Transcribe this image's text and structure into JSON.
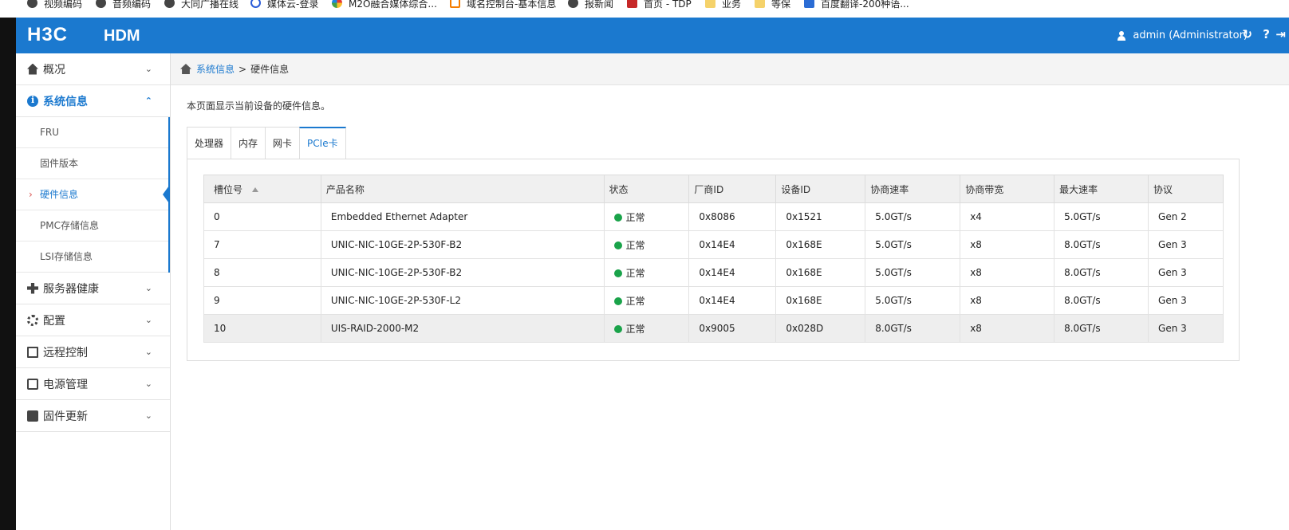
{
  "bookmarks": [
    {
      "label": "视频编码",
      "icon": "globe-icon"
    },
    {
      "label": "音频编码",
      "icon": "globe-icon"
    },
    {
      "label": "大同广播在线",
      "icon": "globe-icon"
    },
    {
      "label": "媒体云-登录",
      "icon": "play-icon"
    },
    {
      "label": "M2O融合媒体综合...",
      "icon": "m2o-icon"
    },
    {
      "label": "域名控制台-基本信息",
      "icon": "bracket-icon"
    },
    {
      "label": "报新闻",
      "icon": "globe-icon"
    },
    {
      "label": "首页 - TDP",
      "icon": "d-icon"
    },
    {
      "label": "业务",
      "icon": "folder-icon"
    },
    {
      "label": "等保",
      "icon": "folder-icon"
    },
    {
      "label": "百度翻译-200种语...",
      "icon": "translate-icon"
    }
  ],
  "header": {
    "logo": "H3C",
    "product": "HDM",
    "user": "admin (Administrator)",
    "refresh_icon": "↻",
    "help_icon": "?",
    "logout_icon": "⇥"
  },
  "sidebar": {
    "items": [
      {
        "label": "概况",
        "icon": "home-icon",
        "expanded": false
      },
      {
        "label": "系统信息",
        "icon": "info-icon",
        "expanded": true,
        "children": [
          {
            "label": "FRU"
          },
          {
            "label": "固件版本"
          },
          {
            "label": "硬件信息",
            "current": true
          },
          {
            "label": "PMC存储信息"
          },
          {
            "label": "LSI存储信息"
          }
        ]
      },
      {
        "label": "服务器健康",
        "icon": "health-icon",
        "expanded": false
      },
      {
        "label": "配置",
        "icon": "gear-icon",
        "expanded": false
      },
      {
        "label": "远程控制",
        "icon": "remote-icon",
        "expanded": false
      },
      {
        "label": "电源管理",
        "icon": "power-icon",
        "expanded": false
      },
      {
        "label": "固件更新",
        "icon": "update-icon",
        "expanded": false
      }
    ],
    "chevron_down": "⌄",
    "chevron_up": "⌃",
    "current_mark": "›"
  },
  "breadcrumb": {
    "parent": "系统信息",
    "separator": ">",
    "current": "硬件信息"
  },
  "main": {
    "description": "本页面显示当前设备的硬件信息。",
    "tabs": [
      {
        "label": "处理器",
        "active": false
      },
      {
        "label": "内存",
        "active": false
      },
      {
        "label": "网卡",
        "active": false
      },
      {
        "label": "PCIe卡",
        "active": true
      }
    ],
    "table": {
      "columns": [
        "槽位号",
        "产品名称",
        "状态",
        "厂商ID",
        "设备ID",
        "协商速率",
        "协商带宽",
        "最大速率",
        "协议"
      ],
      "rows": [
        [
          "0",
          "Embedded Ethernet Adapter",
          "正常",
          "0x8086",
          "0x1521",
          "5.0GT/s",
          "x4",
          "5.0GT/s",
          "Gen 2"
        ],
        [
          "7",
          "UNIC-NIC-10GE-2P-530F-B2",
          "正常",
          "0x14E4",
          "0x168E",
          "5.0GT/s",
          "x8",
          "8.0GT/s",
          "Gen 3"
        ],
        [
          "8",
          "UNIC-NIC-10GE-2P-530F-B2",
          "正常",
          "0x14E4",
          "0x168E",
          "5.0GT/s",
          "x8",
          "8.0GT/s",
          "Gen 3"
        ],
        [
          "9",
          "UNIC-NIC-10GE-2P-530F-L2",
          "正常",
          "0x14E4",
          "0x168E",
          "5.0GT/s",
          "x8",
          "8.0GT/s",
          "Gen 3"
        ],
        [
          "10",
          "UIS-RAID-2000-M2",
          "正常",
          "0x9005",
          "0x028D",
          "8.0GT/s",
          "x8",
          "8.0GT/s",
          "Gen 3"
        ]
      ],
      "status_color": "#1aa34a"
    }
  },
  "colors": {
    "brand": "#1b79cf",
    "sidebar_bg": "#ffffff",
    "black_strip": "#111111"
  }
}
